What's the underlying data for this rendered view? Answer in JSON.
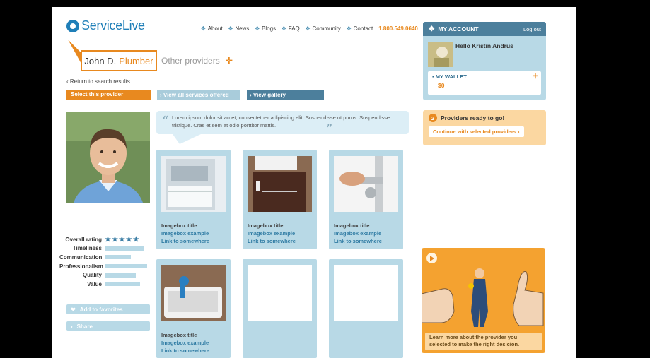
{
  "logo": {
    "text": "ServiceLive"
  },
  "nav": {
    "items": [
      "About",
      "News",
      "Blogs",
      "FAQ",
      "Community",
      "Contact"
    ],
    "phone": "1.800.549.0640"
  },
  "provider": {
    "name": "John D.",
    "trade": "Plumber",
    "other_providers_label": "Other providers",
    "return_label": "Return to search results",
    "select_label": "Select this provider",
    "view_services_label": "View all services offered",
    "view_gallery_label": "View gallery"
  },
  "quote": {
    "text": "Lorem ipsum dolor sit amet, consectetuer adipiscing elit. Suspendisse ut purus. Suspendisse tristique. Cras et sem at odio porttitor mattis."
  },
  "ratings": {
    "overall_label": "Overall rating",
    "overall_stars": "★★★★★",
    "overall_value": 5,
    "items": [
      {
        "label": "Timeliness",
        "value": 0.93
      },
      {
        "label": "Communication",
        "value": 0.62
      },
      {
        "label": "Professionalism",
        "value": 1.0
      },
      {
        "label": "Quality",
        "value": 0.73
      },
      {
        "label": "Value",
        "value": 0.83
      }
    ]
  },
  "actions": {
    "favorites_label": "Add to favorites",
    "share_label": "Share"
  },
  "gallery": [
    {
      "title": "Imagebox title",
      "example": "Imagebox example",
      "link": "Link to somewhere"
    },
    {
      "title": "Imagebox title",
      "example": "Imagebox example",
      "link": "Link to somewhere"
    },
    {
      "title": "Imagebox title",
      "example": "Imagebox example",
      "link": "Link to somewhere"
    },
    {
      "title": "Imagebox title",
      "example": "Imagebox example",
      "link": "Link to somewhere"
    }
  ],
  "account": {
    "title": "MY ACCOUNT",
    "logout": "Log out",
    "greeting": "Hello Kristin Andrus",
    "wallet_label": "MY WALLET",
    "wallet_amount": "$0"
  },
  "ready": {
    "count": "2",
    "text": "Providers ready to go!",
    "continue_label": "Continue with selected providers"
  },
  "promo": {
    "text": "Learn more about the provider you selected to make the right desicion."
  },
  "colors": {
    "orange": "#e8891f",
    "blue_dark": "#4c7f9c",
    "blue_light": "#b8d9e6"
  }
}
